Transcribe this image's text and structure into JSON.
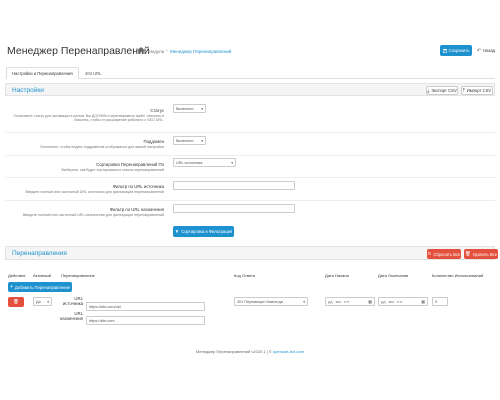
{
  "header": {
    "title": "Менеджер Перенаправлений",
    "breadcrumb_1": "Модули",
    "breadcrumb_2": "Менеджер Перенаправлений",
    "save_label": "Сохранить",
    "back_label": "Назад"
  },
  "tabs": [
    {
      "label": "Настройки и Перенаправления",
      "active": true
    },
    {
      "label": "404 URL",
      "active": false
    }
  ],
  "settings": {
    "title": "Настройки",
    "export_label": "Экспорт CSV",
    "import_label": "Импорт CSV",
    "status": {
      "label": "Статус",
      "help": "Установите статус для активации в целом. Вы ДОЛЖНЫ перенаправить файл .htaccess в .htaccess, чтобы эт расширение работало с SEO URL.",
      "value": "Включено"
    },
    "subdomains": {
      "label": "Поддомен",
      "help": "Отключите, чтобы индекс поддоменов отображался для вашей настройки",
      "value": "Включено"
    },
    "sort": {
      "label": "Сортировка Перенаправлений По",
      "help": "Выберите, как будет сортироваться список перенаправлений",
      "value": "URL источника"
    },
    "filter_from": {
      "label": "Фильтр по URL источника",
      "help": "Введите полный или частичный URL источника для фильтрации перенаправлений",
      "value": ""
    },
    "filter_to": {
      "label": "Фильтр по URL назначения",
      "help": "Введите полный или частичный URL назначения для фильтрации перенаправлений",
      "value": ""
    },
    "sort_filter_label": "Сортировка и Фильтрация"
  },
  "redirects": {
    "title": "Перенаправления",
    "reset_label": "Сбросить Все",
    "delete_all_label": "Удалить Все",
    "add_label": "Добавить Перенаправление",
    "columns": [
      "Действие",
      "Активный",
      "Перенаправление",
      "Код Ответа",
      "Дата Начала",
      "Дата Окончания",
      "Количество Использований"
    ],
    "row": {
      "active": "Да",
      "from_label": "URL источника",
      "from_value": "https://site.com/old",
      "to_label": "URL назначения",
      "to_value": "https://site.com",
      "code": "301 Перемещен Навсегда",
      "date_start": "дд . мм . гггг",
      "date_end": "дд . мм . гггг",
      "count": "0"
    }
  },
  "footer": {
    "text": "Менеджер Перенаправлений v2020.1 | ©",
    "link": "opencart-bot.com"
  }
}
